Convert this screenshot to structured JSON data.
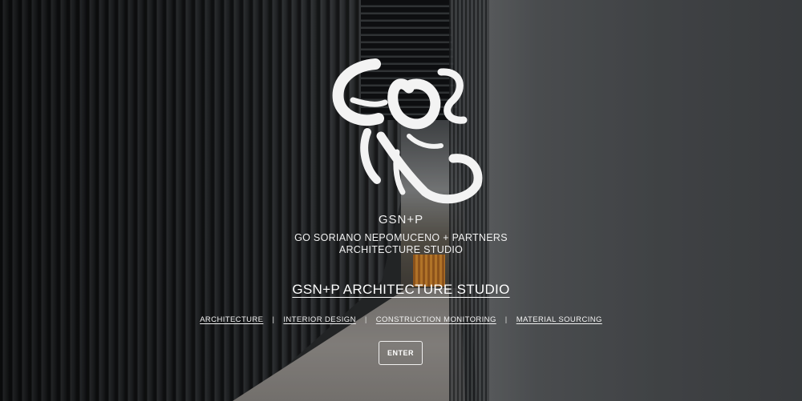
{
  "brand": {
    "logo_alt": "GSN+P calligraphic logo",
    "short_name": "GSN+P",
    "full_name": "GO SORIANO NEPOMUCENO + PARTNERS",
    "studio": "ARCHITECTURE STUDIO"
  },
  "headline": "GSN+P ARCHITECTURE STUDIO",
  "services": [
    {
      "label": "ARCHITECTURE"
    },
    {
      "label": "INTERIOR DESIGN"
    },
    {
      "label": "CONSTRUCTION MONITORING"
    },
    {
      "label": "MATERIAL SOURCING"
    }
  ],
  "separator": "|",
  "enter_label": "ENTER",
  "colors": {
    "text": "#ffffff",
    "logo": "#f3f3f3"
  }
}
